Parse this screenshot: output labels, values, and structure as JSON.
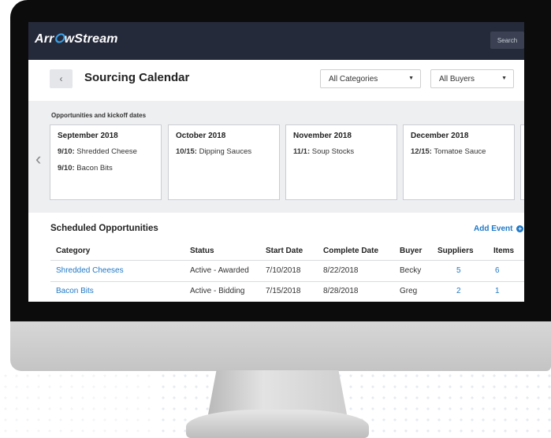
{
  "app": {
    "logo": {
      "pre": "Arr",
      "mark": "⭘",
      "post": "wStream"
    },
    "search_label": "Search"
  },
  "page": {
    "title": "Sourcing Calendar",
    "back_glyph": "‹",
    "category_filter": "All Categories",
    "buyer_filter": "All Buyers"
  },
  "calendar": {
    "heading": "Opportunities and kickoff dates",
    "prev_glyph": "‹",
    "months": [
      {
        "name": "September 2018",
        "events": [
          {
            "date": "9/10:",
            "label": "Shredded Cheese"
          },
          {
            "date": "9/10:",
            "label": "Bacon Bits"
          }
        ]
      },
      {
        "name": "October 2018",
        "events": [
          {
            "date": "10/15:",
            "label": "Dipping Sauces"
          }
        ]
      },
      {
        "name": "November 2018",
        "events": [
          {
            "date": "11/1:",
            "label": "Soup Stocks"
          }
        ]
      },
      {
        "name": "December 2018",
        "events": [
          {
            "date": "12/15:",
            "label": "Tomatoe Sauce"
          }
        ]
      }
    ]
  },
  "opportunities": {
    "title": "Scheduled Opportunities",
    "add_event": "Add Event",
    "columns": [
      "Category",
      "Status",
      "Start Date",
      "Complete Date",
      "Buyer",
      "Suppliers",
      "Items"
    ],
    "rows": [
      {
        "category": "Shredded Cheeses",
        "status": "Active - Awarded",
        "start": "7/10/2018",
        "complete": "8/22/2018",
        "buyer": "Becky",
        "suppliers": "5",
        "items": "6"
      },
      {
        "category": "Bacon Bits",
        "status": "Active - Bidding",
        "start": "7/15/2018",
        "complete": "8/28/2018",
        "buyer": "Greg",
        "suppliers": "2",
        "items": "1"
      }
    ]
  },
  "colors": {
    "topbar": "#252a3a",
    "accent": "#1f79c7",
    "logo_mark": "#3aa0e6"
  }
}
